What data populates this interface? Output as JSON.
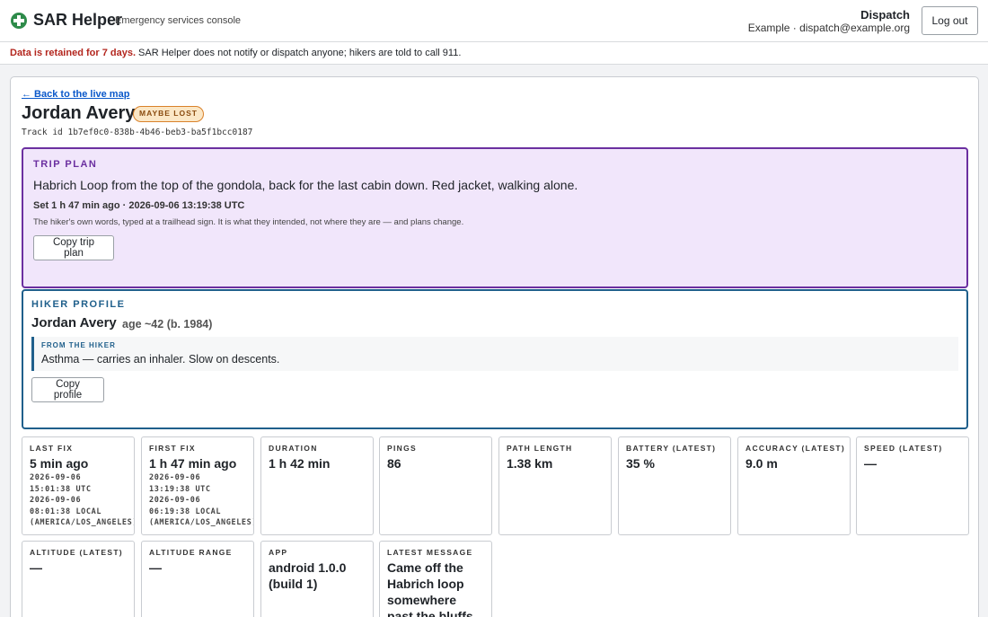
{
  "header": {
    "app_name": "SAR Helper",
    "app_subtitle": "Emergency services console",
    "role": "Dispatch",
    "account": "Example · dispatch@example.org",
    "logout_label": "Log out"
  },
  "notice": {
    "strong": "Data is retained for 7 days.",
    "text": " SAR Helper does not notify or dispatch anyone; hikers are told to call 911."
  },
  "detail": {
    "back_link": "← Back to the live map",
    "name": "Jordan Avery",
    "status_badge": "MAYBE LOST",
    "track_id": "Track id 1b7ef0c0-838b-4b46-beb3-ba5f1bcc0187",
    "trip_plan": {
      "label": "TRIP PLAN",
      "text": "Habrich Loop from the top of the gondola, back for the last cabin down. Red jacket, walking alone.",
      "set": "Set 1 h 47 min ago · 2026-09-06 13:19:38 UTC",
      "note": "The hiker's own words, typed at a trailhead sign. It is what they intended, not where they are — and plans change.",
      "copy_label": "Copy trip plan"
    },
    "profile": {
      "label": "HIKER PROFILE",
      "name": "Jordan Avery",
      "age": "age ~42 (b. 1984)",
      "note_label": "FROM THE HIKER",
      "note_text": "Asthma — carries an inhaler. Slow on descents.",
      "copy_label": "Copy profile"
    },
    "stats": [
      {
        "key": "LAST FIX",
        "value": "5 min ago",
        "detail": "2026-09-06\n15:01:38 UTC\n2026-09-06\n08:01:38 LOCAL\n(AMERICA/LOS_ANGELES)"
      },
      {
        "key": "FIRST FIX",
        "value": "1 h 47 min ago",
        "detail": "2026-09-06\n13:19:38 UTC\n2026-09-06\n06:19:38 LOCAL\n(AMERICA/LOS_ANGELES)"
      },
      {
        "key": "DURATION",
        "value": "1 h 42 min",
        "detail": ""
      },
      {
        "key": "PINGS",
        "value": "86",
        "detail": ""
      },
      {
        "key": "PATH LENGTH",
        "value": "1.38 km",
        "detail": ""
      },
      {
        "key": "BATTERY (LATEST)",
        "value": "35 %",
        "detail": ""
      },
      {
        "key": "ACCURACY (LATEST)",
        "value": "9.0 m",
        "detail": ""
      },
      {
        "key": "SPEED (LATEST)",
        "value": "—",
        "detail": ""
      },
      {
        "key": "ALTITUDE (LATEST)",
        "value": "—",
        "detail": ""
      },
      {
        "key": "ALTITUDE RANGE",
        "value": "—",
        "detail": ""
      },
      {
        "key": "APP",
        "value": "android 1.0.0 (build 1)",
        "detail": ""
      },
      {
        "key": "LATEST MESSAGE",
        "value": "Came off the Habrich loop somewhere past the bluffs —",
        "detail": ""
      }
    ]
  }
}
